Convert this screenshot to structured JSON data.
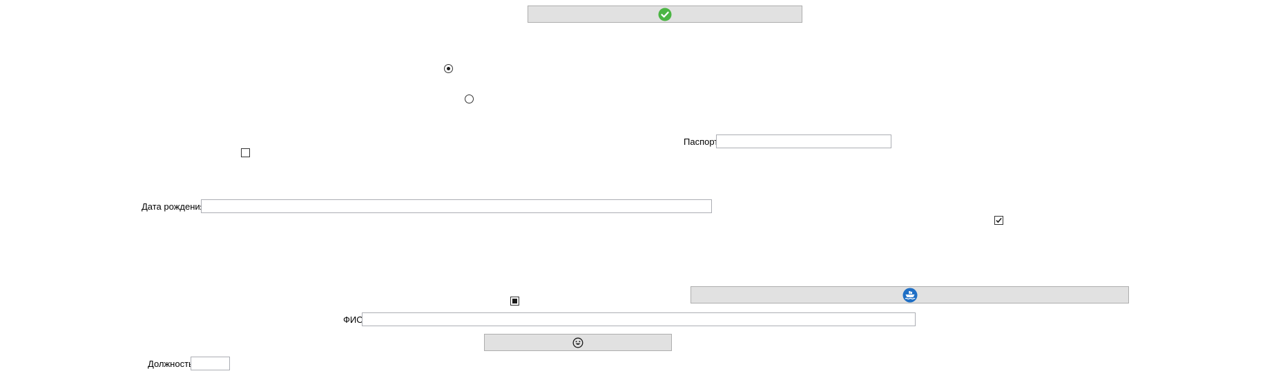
{
  "form": {
    "passport_label": "Паспорт",
    "birthdate_label": "Дата рождения",
    "fullname_label": "ФИО",
    "position_label": "Должность",
    "passport_value": "",
    "birthdate_value": "",
    "fullname_value": "",
    "position_value": ""
  },
  "buttons": {
    "top_icon": "check-circle-icon",
    "middle_icon": "ship-icon",
    "bottom_icon": "smiley-icon"
  },
  "controls": {
    "radio_1_checked": true,
    "radio_2_checked": false,
    "checkbox_1_state": "unchecked",
    "checkbox_2_state": "checked",
    "checkbox_3_state": "indeterminate"
  },
  "colors": {
    "button_bg": "#e1e1e1",
    "button_border": "#adadad",
    "check_green": "#4bb543",
    "ship_blue": "#1f6fc5"
  }
}
